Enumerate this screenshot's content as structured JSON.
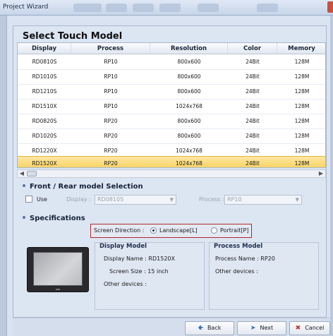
{
  "window": {
    "title": "Project Wizard"
  },
  "heading": "Select Touch Model",
  "table": {
    "columns": [
      "Display",
      "Process",
      "Resolution",
      "Color",
      "Memory"
    ],
    "rows": [
      [
        "RD0810S",
        "RP10",
        "800x600",
        "24Bit",
        "128M"
      ],
      [
        "RD1010S",
        "RP10",
        "800x600",
        "24Bit",
        "128M"
      ],
      [
        "RD1210S",
        "RP10",
        "800x600",
        "24Bit",
        "128M"
      ],
      [
        "RD1510X",
        "RP10",
        "1024x768",
        "24Bit",
        "128M"
      ],
      [
        "RD0820S",
        "RP20",
        "800x600",
        "24Bit",
        "128M"
      ],
      [
        "RD1020S",
        "RP20",
        "800x600",
        "24Bit",
        "128M"
      ],
      [
        "RD1220X",
        "RP20",
        "1024x768",
        "24Bit",
        "128M"
      ],
      [
        "RD1520X",
        "RP20",
        "1024x768",
        "24Bit",
        "128M"
      ]
    ],
    "selected_row": "RD1520X"
  },
  "front_rear": {
    "title": "Front / Rear model Selection",
    "use_label": "Use",
    "display_label": "Display :",
    "display_value": "RD0810S",
    "process_label": "Process :",
    "process_value": "RP10"
  },
  "specs": {
    "title": "Specifications",
    "direction_label": "Screen Direction :",
    "landscape": "Landscape[L]",
    "portrait": "Portrait[P]",
    "display_model": {
      "title": "Display Model",
      "name": "Display Name : RD1520X",
      "size": "Screen Size : 15 inch",
      "other": "Other devices :"
    },
    "process_model": {
      "title": "Process Model",
      "name": "Process Name :  RP20",
      "other": "Other devices :"
    }
  },
  "buttons": {
    "back": "Back",
    "next": "Next",
    "cancel": "Cancel"
  },
  "colors": {
    "selection": "#f8cf56",
    "highlight_border": "#b22a2a",
    "accent": "#2f6ab0"
  }
}
